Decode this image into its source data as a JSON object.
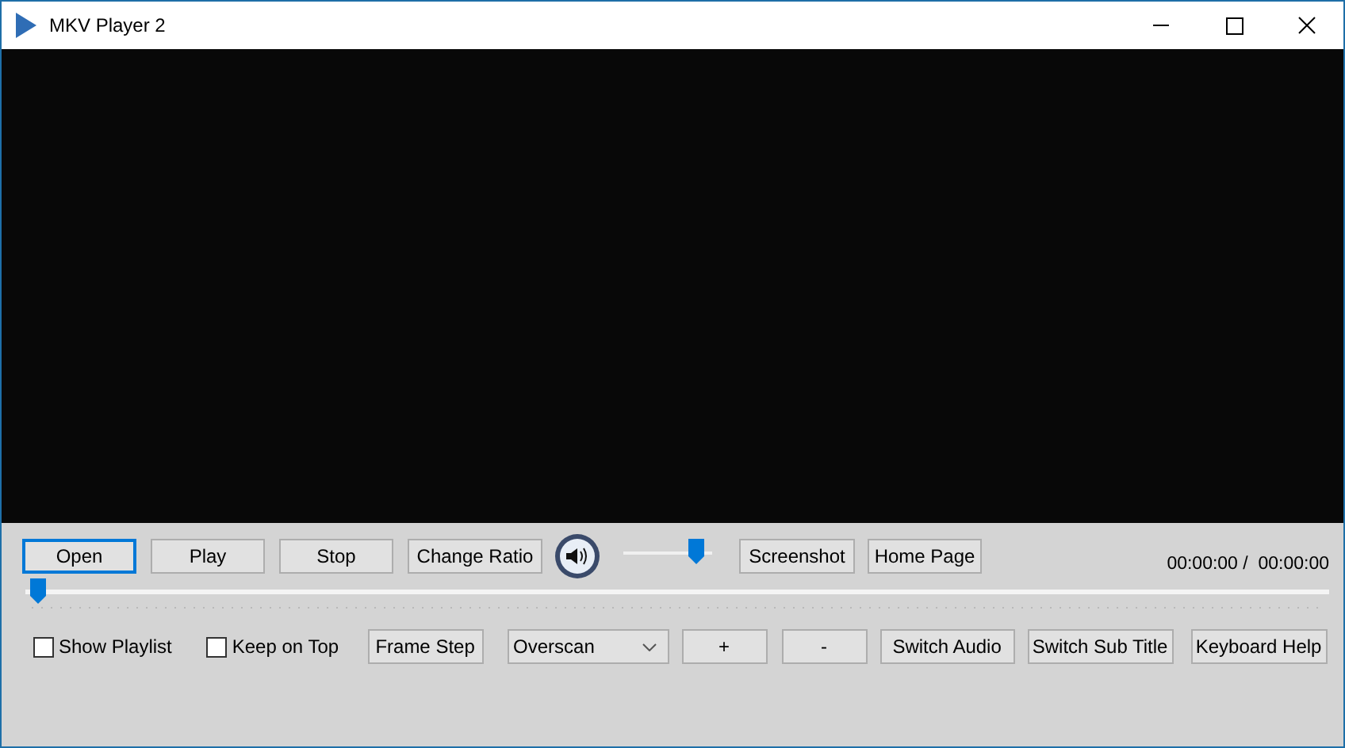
{
  "window": {
    "title": "MKV Player 2"
  },
  "top_controls": [
    {
      "kind": "button",
      "label": "Open",
      "focused": true
    },
    {
      "kind": "button",
      "label": "Play",
      "focused": false
    },
    {
      "kind": "button",
      "label": "Stop",
      "focused": false
    },
    {
      "kind": "button",
      "label": "Change Ratio",
      "focused": false
    },
    {
      "kind": "mute"
    },
    {
      "kind": "volume",
      "level": 0.9
    },
    {
      "kind": "button",
      "label": "Screenshot",
      "focused": false
    },
    {
      "kind": "button",
      "label": "Home Page",
      "focused": false
    }
  ],
  "time": "00:00:00 /  00:00:00",
  "seek": {
    "level": 0
  },
  "bottom_controls": [
    {
      "kind": "checkbox",
      "label": "Show Playlist",
      "checked": false
    },
    {
      "kind": "checkbox",
      "label": "Keep on Top",
      "checked": false
    },
    {
      "kind": "button",
      "label": "Frame Step",
      "focused": false
    },
    {
      "kind": "dropdown",
      "value": "Overscan"
    },
    {
      "kind": "button",
      "label": "+",
      "focused": false
    },
    {
      "kind": "button",
      "label": "-",
      "focused": false
    },
    {
      "kind": "button",
      "label": "Switch Audio",
      "focused": false
    },
    {
      "kind": "button",
      "label": "Switch Sub Title",
      "focused": false
    },
    {
      "kind": "button",
      "label": "Keyboard Help",
      "focused": false
    }
  ]
}
